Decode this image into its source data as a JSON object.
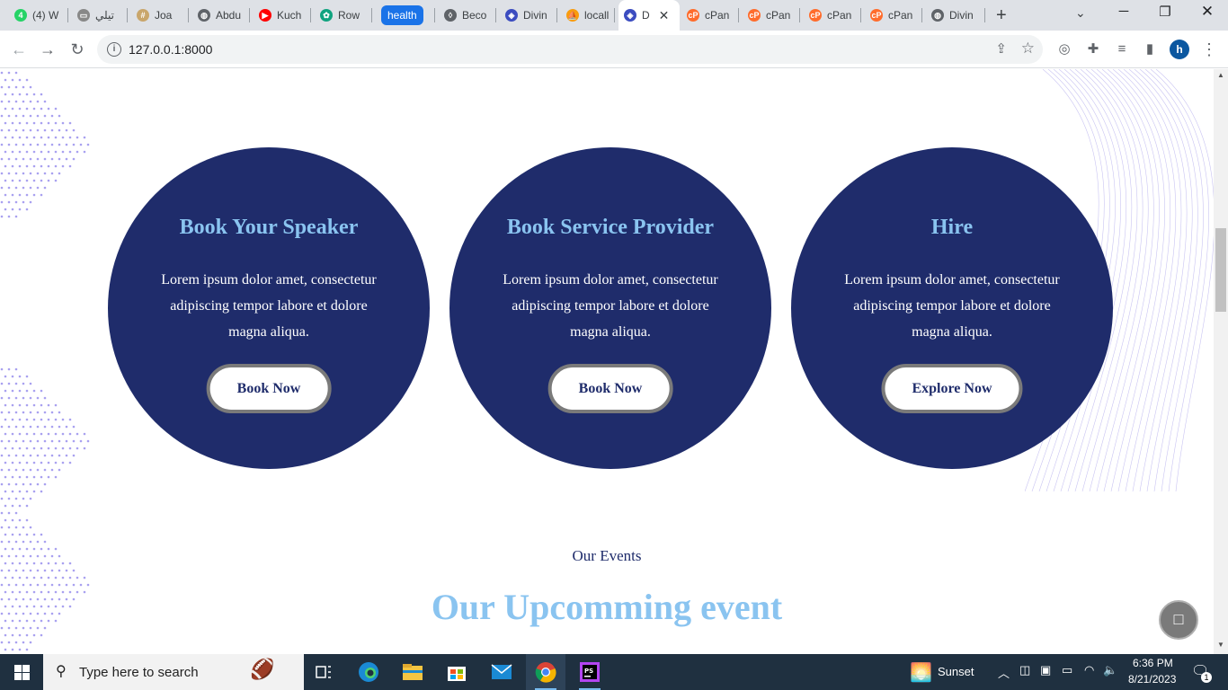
{
  "browser": {
    "tabs": [
      {
        "label": "(4) W",
        "icon": "whatsapp-icon",
        "color": "#25d366",
        "glyph": "4"
      },
      {
        "label": "تيلي",
        "icon": "video-site-icon",
        "color": "#888888",
        "glyph": "▭"
      },
      {
        "label": "Joa",
        "icon": "grid-site-icon",
        "color": "#c9a66b",
        "glyph": "#"
      },
      {
        "label": "Abdu",
        "icon": "globe-icon",
        "color": "#5f6368",
        "glyph": "◍"
      },
      {
        "label": "Kuch",
        "icon": "youtube-icon",
        "color": "#ff0000",
        "glyph": "▶"
      },
      {
        "label": "Row",
        "icon": "chatgpt-icon",
        "color": "#10a37f",
        "glyph": "✿"
      },
      {
        "label": "health",
        "icon": "tab-group-label",
        "color": "#1a73e8",
        "glyph": ""
      },
      {
        "label": "Beco",
        "icon": "location-pin-icon",
        "color": "#5f6368",
        "glyph": "◊"
      },
      {
        "label": "Divin",
        "icon": "divine-site-icon",
        "color": "#3b4cc0",
        "glyph": "◈"
      },
      {
        "label": "locall",
        "icon": "phpmyadmin-icon",
        "color": "#f89c0e",
        "glyph": "⛵"
      },
      {
        "label": "D",
        "icon": "divine-site-icon",
        "color": "#3b4cc0",
        "glyph": "◈",
        "active": true
      },
      {
        "label": "cPan",
        "icon": "cpanel-icon",
        "color": "#ff6c2c",
        "glyph": "cP"
      },
      {
        "label": "cPan",
        "icon": "cpanel-icon",
        "color": "#ff6c2c",
        "glyph": "cP"
      },
      {
        "label": "cPan",
        "icon": "cpanel-icon",
        "color": "#ff6c2c",
        "glyph": "cP"
      },
      {
        "label": "cPan",
        "icon": "cpanel-icon",
        "color": "#ff6c2c",
        "glyph": "cP"
      },
      {
        "label": "Divin",
        "icon": "globe-icon",
        "color": "#5f6368",
        "glyph": "◍"
      }
    ],
    "url": "127.0.0.1:8000",
    "profile_initial": "h"
  },
  "services": [
    {
      "title": "Book Your Speaker",
      "text": "Lorem ipsum dolor amet, consectetur adipiscing tempor labore et dolore magna aliqua.",
      "button": "Book Now"
    },
    {
      "title": "Book Service Provider",
      "text": "Lorem ipsum dolor amet, consectetur adipiscing tempor labore et dolore magna aliqua.",
      "button": "Book Now"
    },
    {
      "title": "Hire",
      "text": "Lorem ipsum dolor amet, consectetur adipiscing tempor labore et dolore magna aliqua.",
      "button": "Explore Now"
    }
  ],
  "events": {
    "subtitle": "Our Events",
    "title": "Our Upcomming event"
  },
  "taskbar": {
    "search_placeholder": "Type here to search",
    "weather": "Sunset",
    "time": "6:36 PM",
    "date": "8/21/2023",
    "notification_count": "1"
  },
  "colors": {
    "circle_bg": "#1f2c6b",
    "heading_blue": "#8ac4f0",
    "button_border": "#7a7a7a"
  }
}
